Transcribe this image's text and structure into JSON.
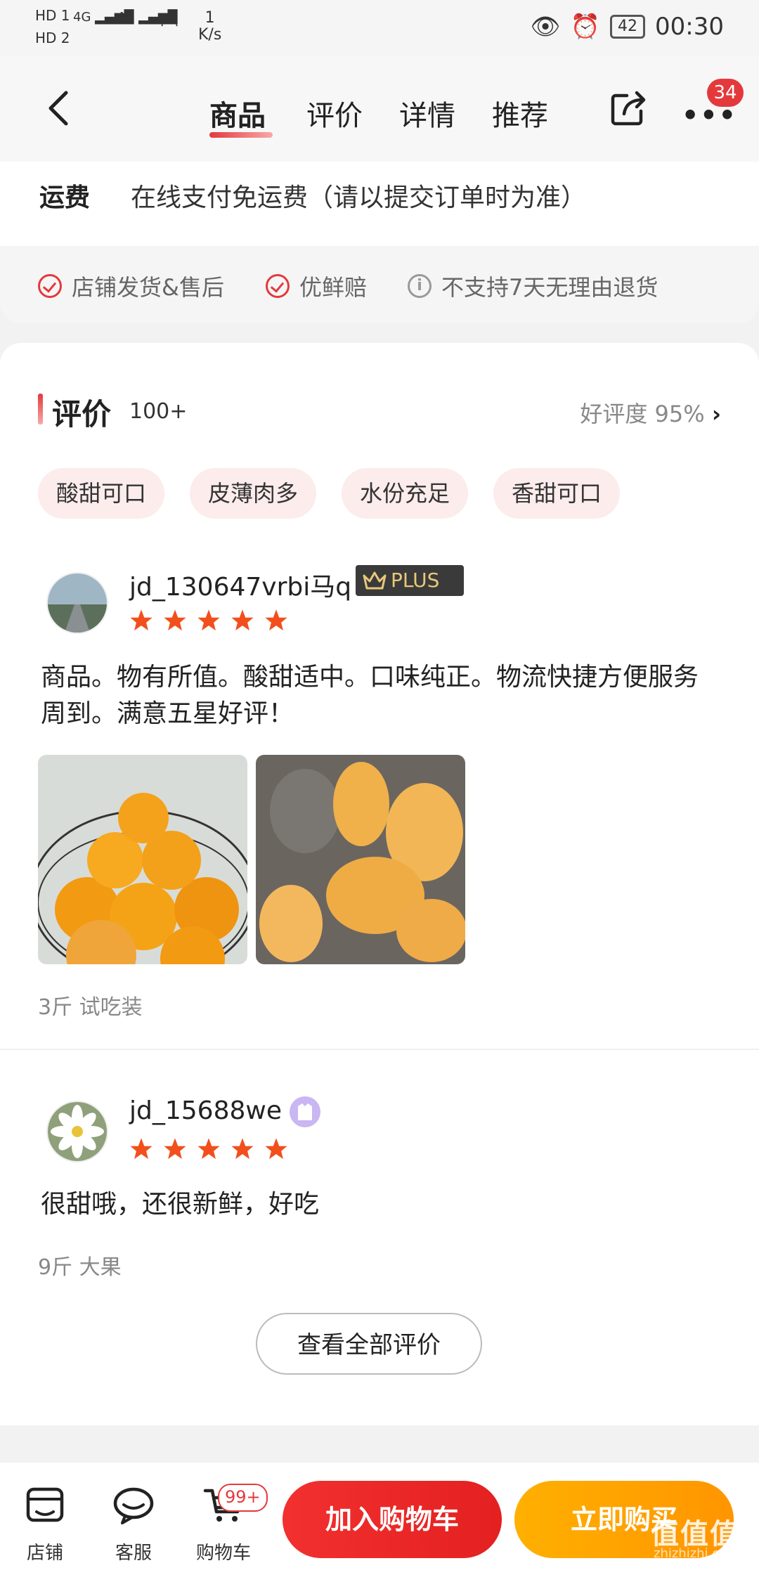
{
  "status_bar": {
    "sim1": "HD 1",
    "sim2": "HD 2",
    "net1": "4G",
    "net2": "4G",
    "speed_value": "1",
    "speed_unit": "K/s",
    "battery": "42",
    "time": "00:30"
  },
  "nav": {
    "tabs": [
      "商品",
      "评价",
      "详情",
      "推荐"
    ],
    "active_tab": 0,
    "more_badge": "34"
  },
  "shipping": {
    "label": "运费",
    "text": "在线支付免运费（请以提交订单时为准）"
  },
  "services": [
    {
      "icon": "check-circle-icon",
      "label": "店铺发货&售后"
    },
    {
      "icon": "check-circle-icon",
      "label": "优鲜赔"
    },
    {
      "icon": "info-circle-icon",
      "label": "不支持7天无理由退货"
    }
  ],
  "reviews_section": {
    "title": "评价",
    "count": "100+",
    "rate_text": "好评度 95%",
    "tags": [
      "酸甜可口",
      "皮薄肉多",
      "水份充足",
      "香甜可口"
    ],
    "reviews": [
      {
        "user": "jd_130647vrbi马q",
        "badge": "PLUS",
        "stars": 5,
        "text": "商品。物有所值。酸甜适中。口味纯正。物流快捷方便服务周到。满意五星好评！",
        "spec": "3斤 试吃装"
      },
      {
        "user": "jd_15688we",
        "badge": "",
        "stars": 5,
        "text": "很甜哦，还很新鲜，好吃",
        "spec": "9斤 大果"
      }
    ],
    "view_all": "查看全部评价"
  },
  "bottom_bar": {
    "shop": "店铺",
    "service": "客服",
    "cart": "购物车",
    "cart_badge": "99+",
    "add_to_cart": "加入购物车",
    "buy_now": "立即购买"
  },
  "watermark": {
    "text": "值值值",
    "sub": "zhizhizhi.com"
  },
  "colors": {
    "accent": "#e4393c",
    "buy": "#ff9f00",
    "star": "#f24f1c"
  }
}
